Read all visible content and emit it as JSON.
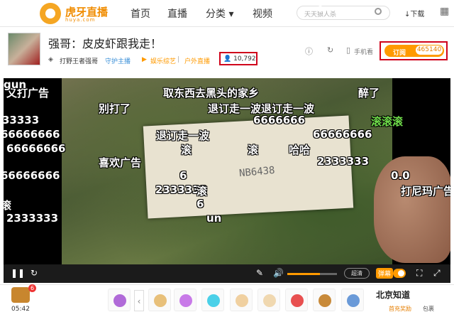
{
  "topbar": {
    "brand": "虎牙直播",
    "brand_sub": "huya.com",
    "nav": [
      "首页",
      "直播",
      "分类 ▾",
      "视频"
    ],
    "search_placeholder": "天天狼人杀",
    "download": "↓下载",
    "more": "▦"
  },
  "room": {
    "title": "强哥：皮皮虾跟我走！",
    "badge": "打野王者强哥",
    "guard": "守护主播",
    "category": "娱乐综艺",
    "subcategory": "户外直播",
    "views": "10,792",
    "mobile": "手机看",
    "subscribe_label": "订阅",
    "subscribe_count": "465140"
  },
  "danmaku": [
    {
      "text": "又打广告",
      "green": false
    },
    {
      "text": "取东西去黑头的家乡",
      "green": false
    },
    {
      "text": "醉了",
      "green": false
    },
    {
      "text": "别打了",
      "green": false
    },
    {
      "text": "退订走一波退订走一波",
      "green": false
    },
    {
      "text": "33333",
      "green": false
    },
    {
      "text": "6666666",
      "green": false
    },
    {
      "text": "滚滚滚",
      "green": true
    },
    {
      "text": "66666666",
      "green": false
    },
    {
      "text": "66666666",
      "green": false
    },
    {
      "text": "退订走一波",
      "green": false
    },
    {
      "text": "66666666",
      "green": false
    },
    {
      "text": "滚",
      "green": false
    },
    {
      "text": "滚",
      "green": false
    },
    {
      "text": "哈哈",
      "green": false
    },
    {
      "text": "喜欢广告",
      "green": false
    },
    {
      "text": "2333333",
      "green": false
    },
    {
      "text": "66666666",
      "green": false
    },
    {
      "text": "6",
      "green": false
    },
    {
      "text": "0.0",
      "green": false
    },
    {
      "text": "2333333",
      "green": false
    },
    {
      "text": "滚",
      "green": false
    },
    {
      "text": "打尼玛广告",
      "green": false
    },
    {
      "text": "滚",
      "green": false
    },
    {
      "text": "6",
      "green": false
    },
    {
      "text": "2333333",
      "green": false
    },
    {
      "text": "un",
      "green": false
    },
    {
      "text": "gun",
      "green": false
    }
  ],
  "video": {
    "card_text": "NB6438"
  },
  "controls": {
    "quality": "超清",
    "danmaku_btn": "弹幕",
    "volume_level": 0.65
  },
  "giftbar": {
    "chest_badge": "6",
    "time": "05:42",
    "top_up": "首充奖励",
    "package": "包裹",
    "watermark": "北京知道"
  }
}
